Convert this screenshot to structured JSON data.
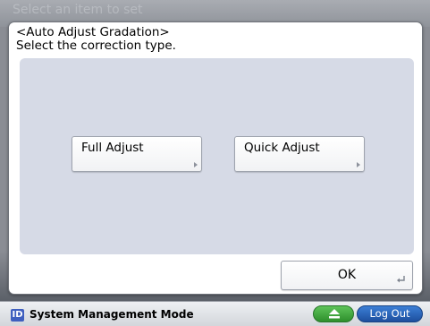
{
  "background": {
    "header_text": "Select an item to set"
  },
  "dialog": {
    "title": "<Auto Adjust Gradation>",
    "subtitle": "Select the correction type.",
    "buttons": {
      "full_adjust": "Full Adjust",
      "quick_adjust": "Quick Adjust",
      "ok": "OK"
    }
  },
  "statusbar": {
    "badge": "ID",
    "mode_text": "System Management Mode",
    "logout_label": "Log Out"
  },
  "colors": {
    "panel": "#d6dae6",
    "eject_green": "#3aa838",
    "logout_blue": "#2a62b8",
    "id_badge_blue": "#3e5fbf"
  },
  "icons": {
    "eject": "eject-icon",
    "ok_return": "return-arrow-icon",
    "submenu_arrow": "triangle-right-icon"
  }
}
